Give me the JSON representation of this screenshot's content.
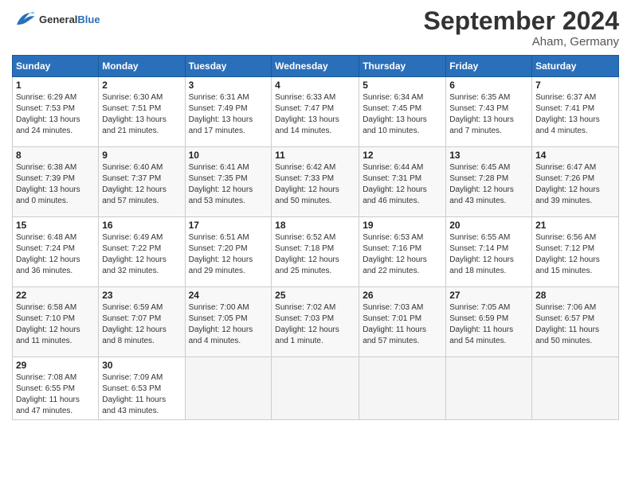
{
  "header": {
    "logo_general": "General",
    "logo_blue": "Blue",
    "month": "September 2024",
    "location": "Aham, Germany"
  },
  "days_of_week": [
    "Sunday",
    "Monday",
    "Tuesday",
    "Wednesday",
    "Thursday",
    "Friday",
    "Saturday"
  ],
  "weeks": [
    [
      {
        "day": "1",
        "info": "Sunrise: 6:29 AM\nSunset: 7:53 PM\nDaylight: 13 hours\nand 24 minutes."
      },
      {
        "day": "2",
        "info": "Sunrise: 6:30 AM\nSunset: 7:51 PM\nDaylight: 13 hours\nand 21 minutes."
      },
      {
        "day": "3",
        "info": "Sunrise: 6:31 AM\nSunset: 7:49 PM\nDaylight: 13 hours\nand 17 minutes."
      },
      {
        "day": "4",
        "info": "Sunrise: 6:33 AM\nSunset: 7:47 PM\nDaylight: 13 hours\nand 14 minutes."
      },
      {
        "day": "5",
        "info": "Sunrise: 6:34 AM\nSunset: 7:45 PM\nDaylight: 13 hours\nand 10 minutes."
      },
      {
        "day": "6",
        "info": "Sunrise: 6:35 AM\nSunset: 7:43 PM\nDaylight: 13 hours\nand 7 minutes."
      },
      {
        "day": "7",
        "info": "Sunrise: 6:37 AM\nSunset: 7:41 PM\nDaylight: 13 hours\nand 4 minutes."
      }
    ],
    [
      {
        "day": "8",
        "info": "Sunrise: 6:38 AM\nSunset: 7:39 PM\nDaylight: 13 hours\nand 0 minutes."
      },
      {
        "day": "9",
        "info": "Sunrise: 6:40 AM\nSunset: 7:37 PM\nDaylight: 12 hours\nand 57 minutes."
      },
      {
        "day": "10",
        "info": "Sunrise: 6:41 AM\nSunset: 7:35 PM\nDaylight: 12 hours\nand 53 minutes."
      },
      {
        "day": "11",
        "info": "Sunrise: 6:42 AM\nSunset: 7:33 PM\nDaylight: 12 hours\nand 50 minutes."
      },
      {
        "day": "12",
        "info": "Sunrise: 6:44 AM\nSunset: 7:31 PM\nDaylight: 12 hours\nand 46 minutes."
      },
      {
        "day": "13",
        "info": "Sunrise: 6:45 AM\nSunset: 7:28 PM\nDaylight: 12 hours\nand 43 minutes."
      },
      {
        "day": "14",
        "info": "Sunrise: 6:47 AM\nSunset: 7:26 PM\nDaylight: 12 hours\nand 39 minutes."
      }
    ],
    [
      {
        "day": "15",
        "info": "Sunrise: 6:48 AM\nSunset: 7:24 PM\nDaylight: 12 hours\nand 36 minutes."
      },
      {
        "day": "16",
        "info": "Sunrise: 6:49 AM\nSunset: 7:22 PM\nDaylight: 12 hours\nand 32 minutes."
      },
      {
        "day": "17",
        "info": "Sunrise: 6:51 AM\nSunset: 7:20 PM\nDaylight: 12 hours\nand 29 minutes."
      },
      {
        "day": "18",
        "info": "Sunrise: 6:52 AM\nSunset: 7:18 PM\nDaylight: 12 hours\nand 25 minutes."
      },
      {
        "day": "19",
        "info": "Sunrise: 6:53 AM\nSunset: 7:16 PM\nDaylight: 12 hours\nand 22 minutes."
      },
      {
        "day": "20",
        "info": "Sunrise: 6:55 AM\nSunset: 7:14 PM\nDaylight: 12 hours\nand 18 minutes."
      },
      {
        "day": "21",
        "info": "Sunrise: 6:56 AM\nSunset: 7:12 PM\nDaylight: 12 hours\nand 15 minutes."
      }
    ],
    [
      {
        "day": "22",
        "info": "Sunrise: 6:58 AM\nSunset: 7:10 PM\nDaylight: 12 hours\nand 11 minutes."
      },
      {
        "day": "23",
        "info": "Sunrise: 6:59 AM\nSunset: 7:07 PM\nDaylight: 12 hours\nand 8 minutes."
      },
      {
        "day": "24",
        "info": "Sunrise: 7:00 AM\nSunset: 7:05 PM\nDaylight: 12 hours\nand 4 minutes."
      },
      {
        "day": "25",
        "info": "Sunrise: 7:02 AM\nSunset: 7:03 PM\nDaylight: 12 hours\nand 1 minute."
      },
      {
        "day": "26",
        "info": "Sunrise: 7:03 AM\nSunset: 7:01 PM\nDaylight: 11 hours\nand 57 minutes."
      },
      {
        "day": "27",
        "info": "Sunrise: 7:05 AM\nSunset: 6:59 PM\nDaylight: 11 hours\nand 54 minutes."
      },
      {
        "day": "28",
        "info": "Sunrise: 7:06 AM\nSunset: 6:57 PM\nDaylight: 11 hours\nand 50 minutes."
      }
    ],
    [
      {
        "day": "29",
        "info": "Sunrise: 7:08 AM\nSunset: 6:55 PM\nDaylight: 11 hours\nand 47 minutes."
      },
      {
        "day": "30",
        "info": "Sunrise: 7:09 AM\nSunset: 6:53 PM\nDaylight: 11 hours\nand 43 minutes."
      },
      {
        "day": "",
        "info": ""
      },
      {
        "day": "",
        "info": ""
      },
      {
        "day": "",
        "info": ""
      },
      {
        "day": "",
        "info": ""
      },
      {
        "day": "",
        "info": ""
      }
    ]
  ]
}
